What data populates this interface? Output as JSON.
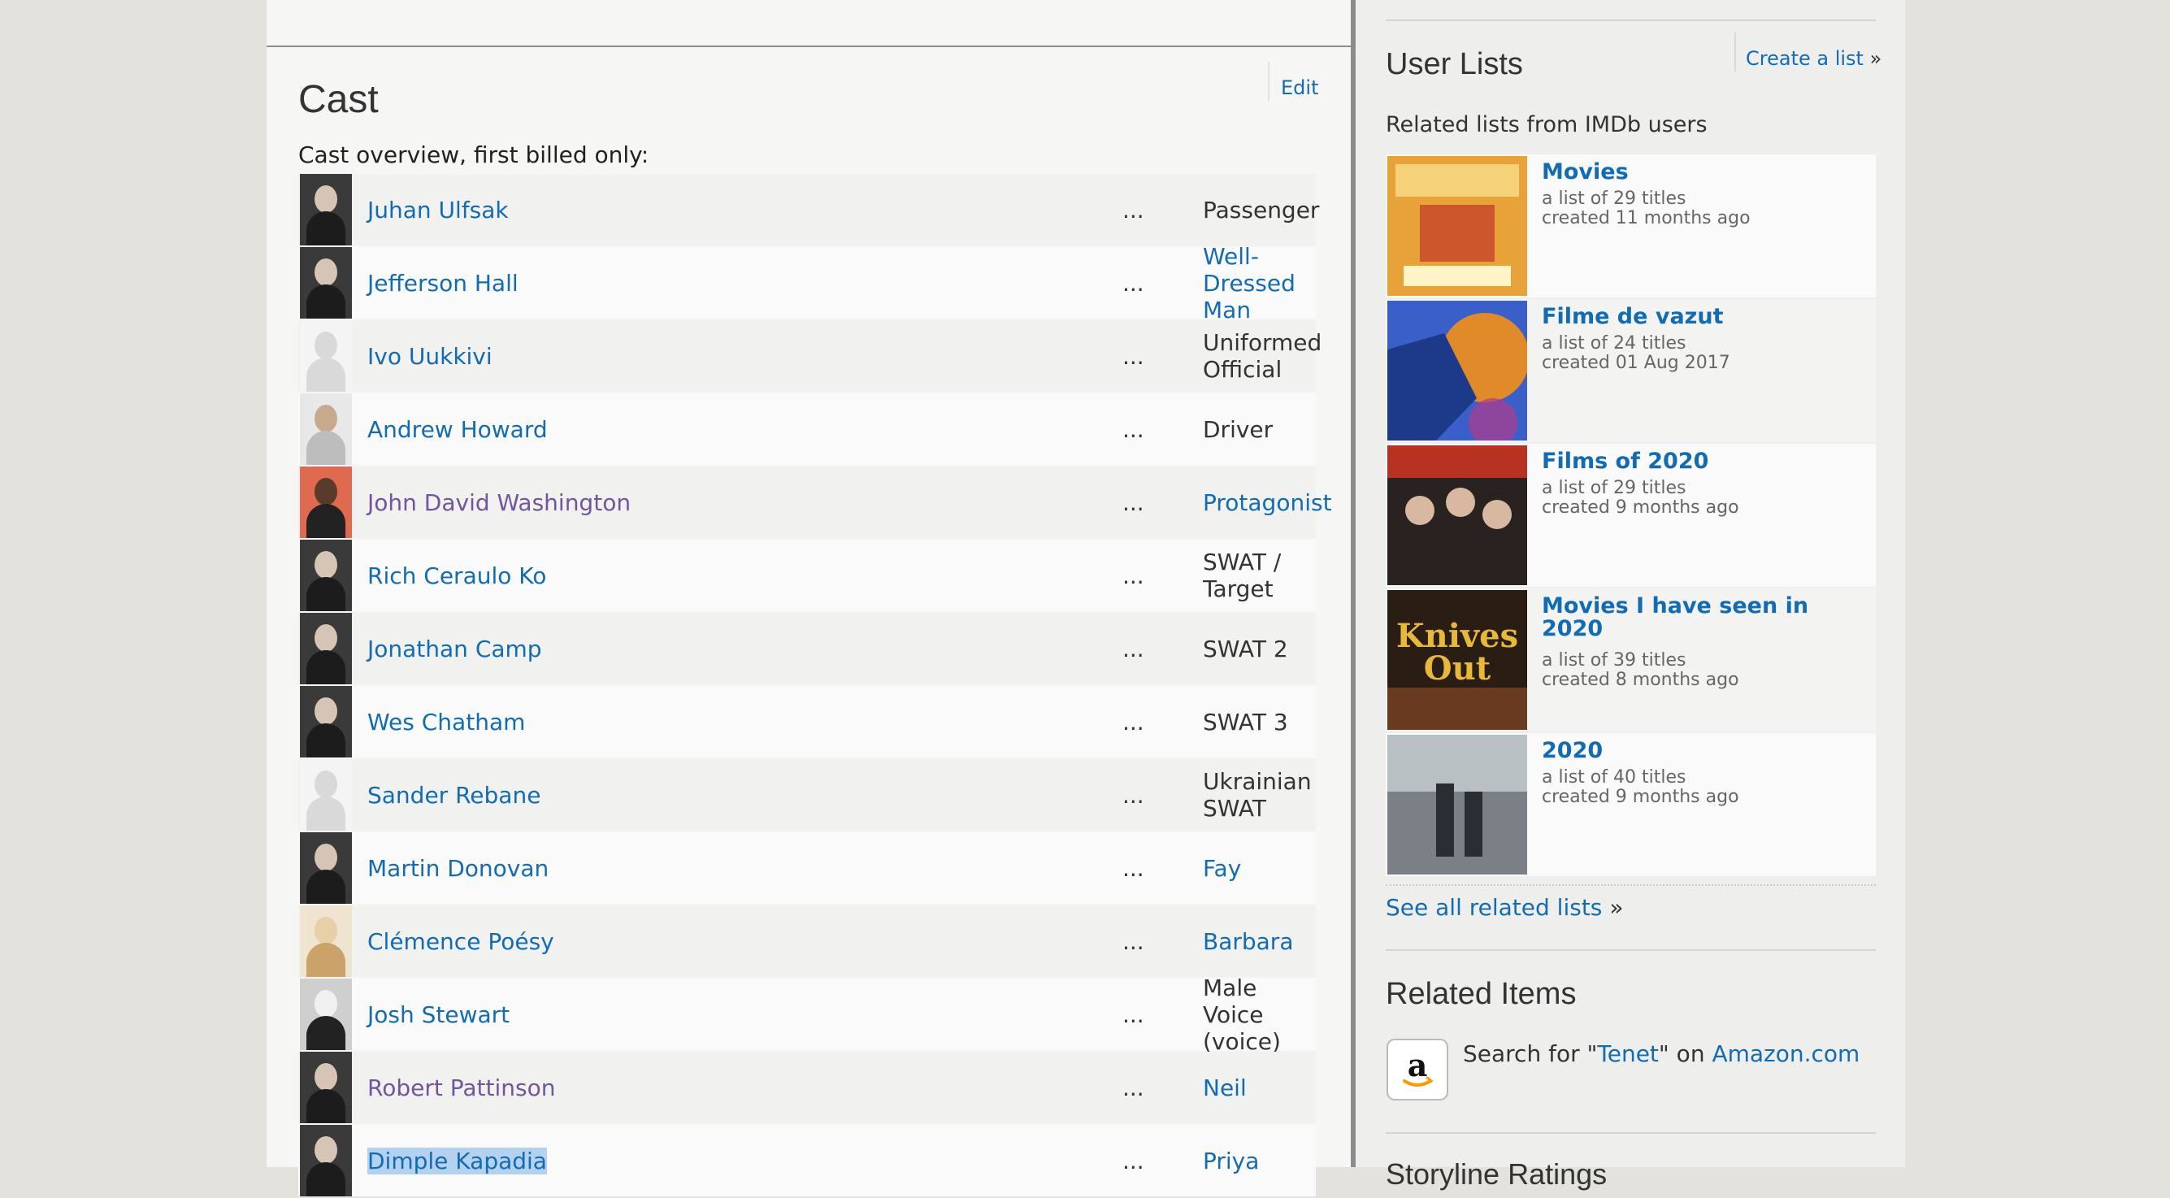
{
  "cast": {
    "title": "Cast",
    "edit_label": "Edit",
    "overview_label": "Cast overview, first billed only:",
    "dots": "...",
    "rows": [
      {
        "name": "Juhan Ulfsak",
        "role": "Passenger",
        "role_is_link": false,
        "name_visited": false,
        "photo": "dark-portrait"
      },
      {
        "name": "Jefferson Hall",
        "role": "Well-Dressed Man",
        "role_is_link": true,
        "name_visited": false,
        "photo": "dark-portrait"
      },
      {
        "name": "Ivo Uukkivi",
        "role": "Uniformed Official",
        "role_is_link": false,
        "name_visited": false,
        "photo": "placeholder"
      },
      {
        "name": "Andrew Howard",
        "role": "Driver",
        "role_is_link": false,
        "name_visited": false,
        "photo": "light-portrait"
      },
      {
        "name": "John David Washington",
        "role": "Protagonist",
        "role_is_link": true,
        "name_visited": true,
        "photo": "red-portrait"
      },
      {
        "name": "Rich Ceraulo Ko",
        "role": "SWAT / Target",
        "role_is_link": false,
        "name_visited": false,
        "photo": "dark-portrait"
      },
      {
        "name": "Jonathan Camp",
        "role": "SWAT 2",
        "role_is_link": false,
        "name_visited": false,
        "photo": "dark-portrait"
      },
      {
        "name": "Wes Chatham",
        "role": "SWAT 3",
        "role_is_link": false,
        "name_visited": false,
        "photo": "dark-portrait"
      },
      {
        "name": "Sander Rebane",
        "role": "Ukrainian SWAT",
        "role_is_link": false,
        "name_visited": false,
        "photo": "placeholder"
      },
      {
        "name": "Martin Donovan",
        "role": "Fay",
        "role_is_link": true,
        "name_visited": false,
        "photo": "dark-portrait"
      },
      {
        "name": "Clémence Poésy",
        "role": "Barbara",
        "role_is_link": true,
        "name_visited": false,
        "photo": "blonde-portrait"
      },
      {
        "name": "Josh Stewart",
        "role": "Male Voice (voice)",
        "role_is_link": false,
        "name_visited": false,
        "photo": "bw-portrait"
      },
      {
        "name": "Robert Pattinson",
        "role": "Neil",
        "role_is_link": true,
        "name_visited": true,
        "photo": "dark-portrait"
      },
      {
        "name": "Dimple Kapadia",
        "role": "Priya",
        "role_is_link": true,
        "name_visited": false,
        "photo": "dark-portrait",
        "selected": true
      }
    ]
  },
  "sidebar": {
    "user_lists_title": "User Lists",
    "create_list_label": "Create a list",
    "raquo": "»",
    "related_intro": "Related lists from IMDb users",
    "lists": [
      {
        "title": "Movies",
        "count": "a list of 29 titles",
        "created": "created 11 months ago",
        "poster": "orange"
      },
      {
        "title": "Filme de vazut",
        "count": "a list of 24 titles",
        "created": "created 01 Aug 2017",
        "poster": "blue"
      },
      {
        "title": "Films of 2020",
        "count": "a list of 29 titles",
        "created": "created 9 months ago",
        "poster": "red"
      },
      {
        "title": "Movies I have seen in 2020",
        "count": "a list of 39 titles",
        "created": "created 8 months ago",
        "poster": "knives"
      },
      {
        "title": "2020",
        "count": "a list of 40 titles",
        "created": "created 9 months ago",
        "poster": "grey"
      }
    ],
    "see_all_label": "See all related lists",
    "related_items_title": "Related Items",
    "amazon": {
      "prefix": "Search for \"",
      "query": "Tenet",
      "middle": "\" on ",
      "store": "Amazon.com"
    },
    "next_section_title": "Storyline Ratings"
  },
  "colors": {
    "link": "#136cb2",
    "visited_link": "#70579d",
    "selection": "#b4d1f0"
  }
}
